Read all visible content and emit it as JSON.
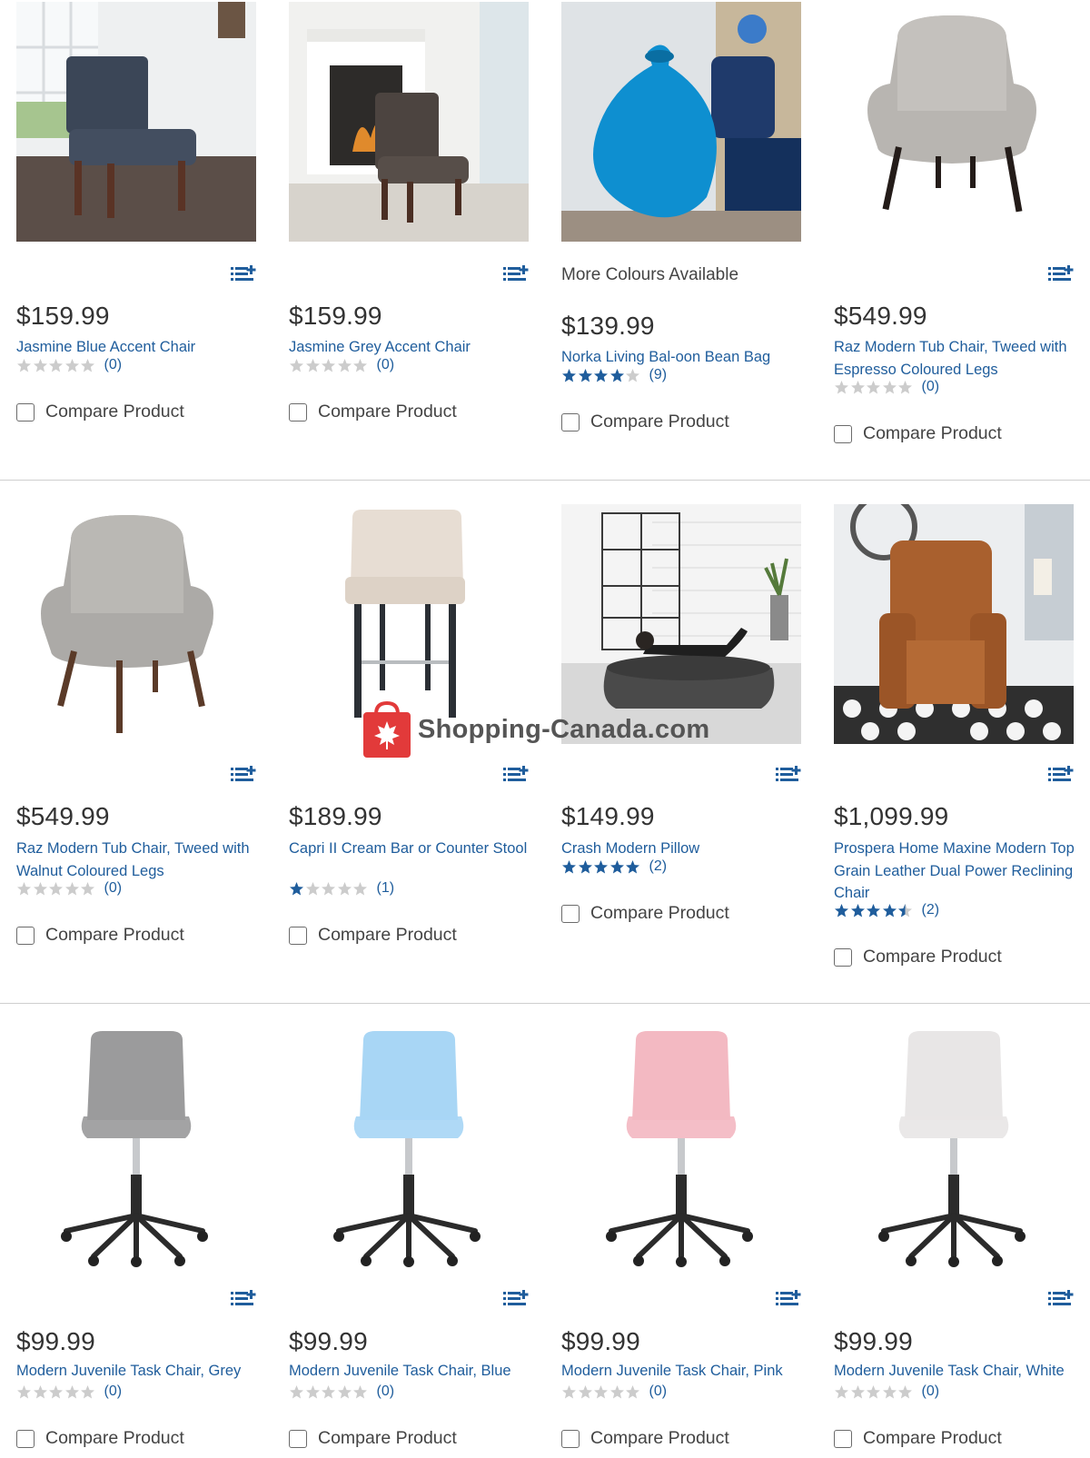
{
  "compare_label": "Compare Product",
  "watermark": {
    "text": "Shopping-Canada.com",
    "color": "#555555",
    "accent": "#e23a3a"
  },
  "colors": {
    "link": "#1f5d9c",
    "star_filled": "#1f5d9c",
    "star_empty": "#cccccc",
    "divider": "#cfcfcf"
  },
  "products": [
    {
      "price": "$159.99",
      "name": "Jasmine Blue Accent Chair",
      "rating": 0,
      "reviews": "(0)",
      "note": "",
      "icon": "blue-accent-chair-photo"
    },
    {
      "price": "$159.99",
      "name": "Jasmine Grey Accent Chair",
      "rating": 0,
      "reviews": "(0)",
      "note": "",
      "icon": "grey-accent-chair-photo"
    },
    {
      "price": "$139.99",
      "name": "Norka Living Bal-oon Bean Bag",
      "rating": 4,
      "reviews": "(9)",
      "note": "More Colours Available",
      "icon": "bean-bag-photo"
    },
    {
      "price": "$549.99",
      "name": "Raz Modern Tub Chair, Tweed with Espresso Coloured Legs",
      "rating": 0,
      "reviews": "(0)",
      "note": "",
      "icon": "tub-chair-photo"
    },
    {
      "price": "$549.99",
      "name": "Raz Modern Tub Chair, Tweed with Walnut Coloured Legs",
      "rating": 0,
      "reviews": "(0)",
      "note": "",
      "icon": "tub-chair-walnut-photo"
    },
    {
      "price": "$189.99",
      "name": "Capri II Cream Bar or Counter Stool",
      "rating": 1,
      "reviews": "(1)",
      "note": "",
      "icon": "bar-stool-photo"
    },
    {
      "price": "$149.99",
      "name": "Crash Modern Pillow",
      "rating": 5,
      "reviews": "(2)",
      "note": "",
      "icon": "floor-pillow-photo"
    },
    {
      "price": "$1,099.99",
      "name": "Prospera Home Maxine Modern Top Grain Leather Dual Power Reclining Chair",
      "rating": 4.5,
      "reviews": "(2)",
      "note": "",
      "icon": "recliner-photo"
    },
    {
      "price": "$99.99",
      "name": "Modern Juvenile Task Chair, Grey",
      "rating": 0,
      "reviews": "(0)",
      "note": "",
      "icon": "task-chair-grey-photo"
    },
    {
      "price": "$99.99",
      "name": "Modern Juvenile Task Chair, Blue",
      "rating": 0,
      "reviews": "(0)",
      "note": "",
      "icon": "task-chair-blue-photo"
    },
    {
      "price": "$99.99",
      "name": "Modern Juvenile Task Chair, Pink",
      "rating": 0,
      "reviews": "(0)",
      "note": "",
      "icon": "task-chair-pink-photo"
    },
    {
      "price": "$99.99",
      "name": "Modern Juvenile Task Chair, White",
      "rating": 0,
      "reviews": "(0)",
      "note": "",
      "icon": "task-chair-white-photo"
    }
  ]
}
